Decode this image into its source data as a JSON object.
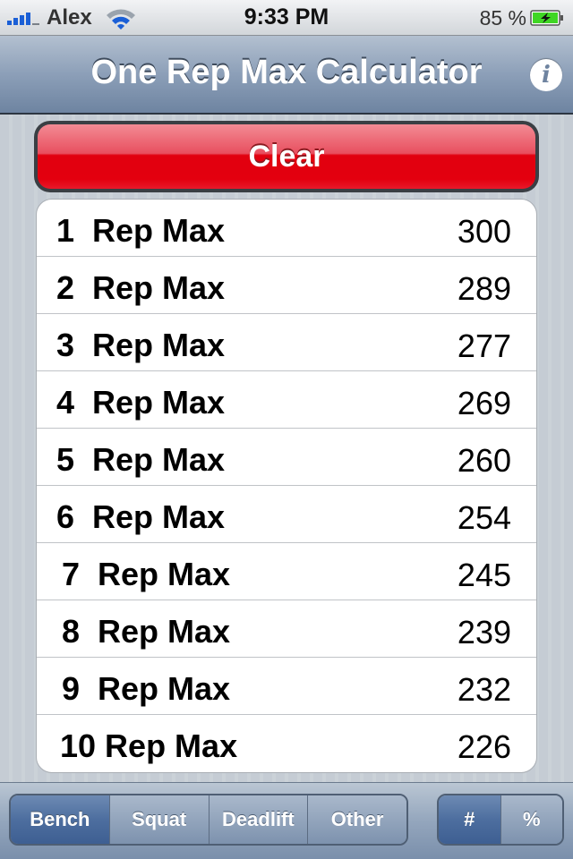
{
  "status_bar": {
    "carrier": "Alex",
    "time": "9:33 PM",
    "battery_percent": "85 %",
    "signal_bars": 4,
    "battery_level": 0.85,
    "charging": true
  },
  "nav": {
    "title": "One Rep Max Calculator",
    "info_icon": "info-icon"
  },
  "clear_button": {
    "label": "Clear",
    "color": "#e1000f"
  },
  "rep_maxes": [
    {
      "label": "1  Rep Max",
      "value": "300"
    },
    {
      "label": "2  Rep Max",
      "value": "289"
    },
    {
      "label": "3  Rep Max",
      "value": "277"
    },
    {
      "label": "4  Rep Max",
      "value": "269"
    },
    {
      "label": "5  Rep Max",
      "value": "260"
    },
    {
      "label": "6  Rep Max",
      "value": "254"
    },
    {
      "label": "7  Rep Max",
      "value": "245"
    },
    {
      "label": "8  Rep Max",
      "value": "239"
    },
    {
      "label": "9  Rep Max",
      "value": "232"
    },
    {
      "label": "10 Rep Max",
      "value": "226"
    }
  ],
  "toolbar": {
    "exercises": [
      {
        "label": "Bench",
        "selected": true
      },
      {
        "label": "Squat",
        "selected": false
      },
      {
        "label": "Deadlift",
        "selected": false
      },
      {
        "label": "Other",
        "selected": false
      }
    ],
    "modes": [
      {
        "label": "#",
        "selected": true
      },
      {
        "label": "%",
        "selected": false
      }
    ]
  }
}
